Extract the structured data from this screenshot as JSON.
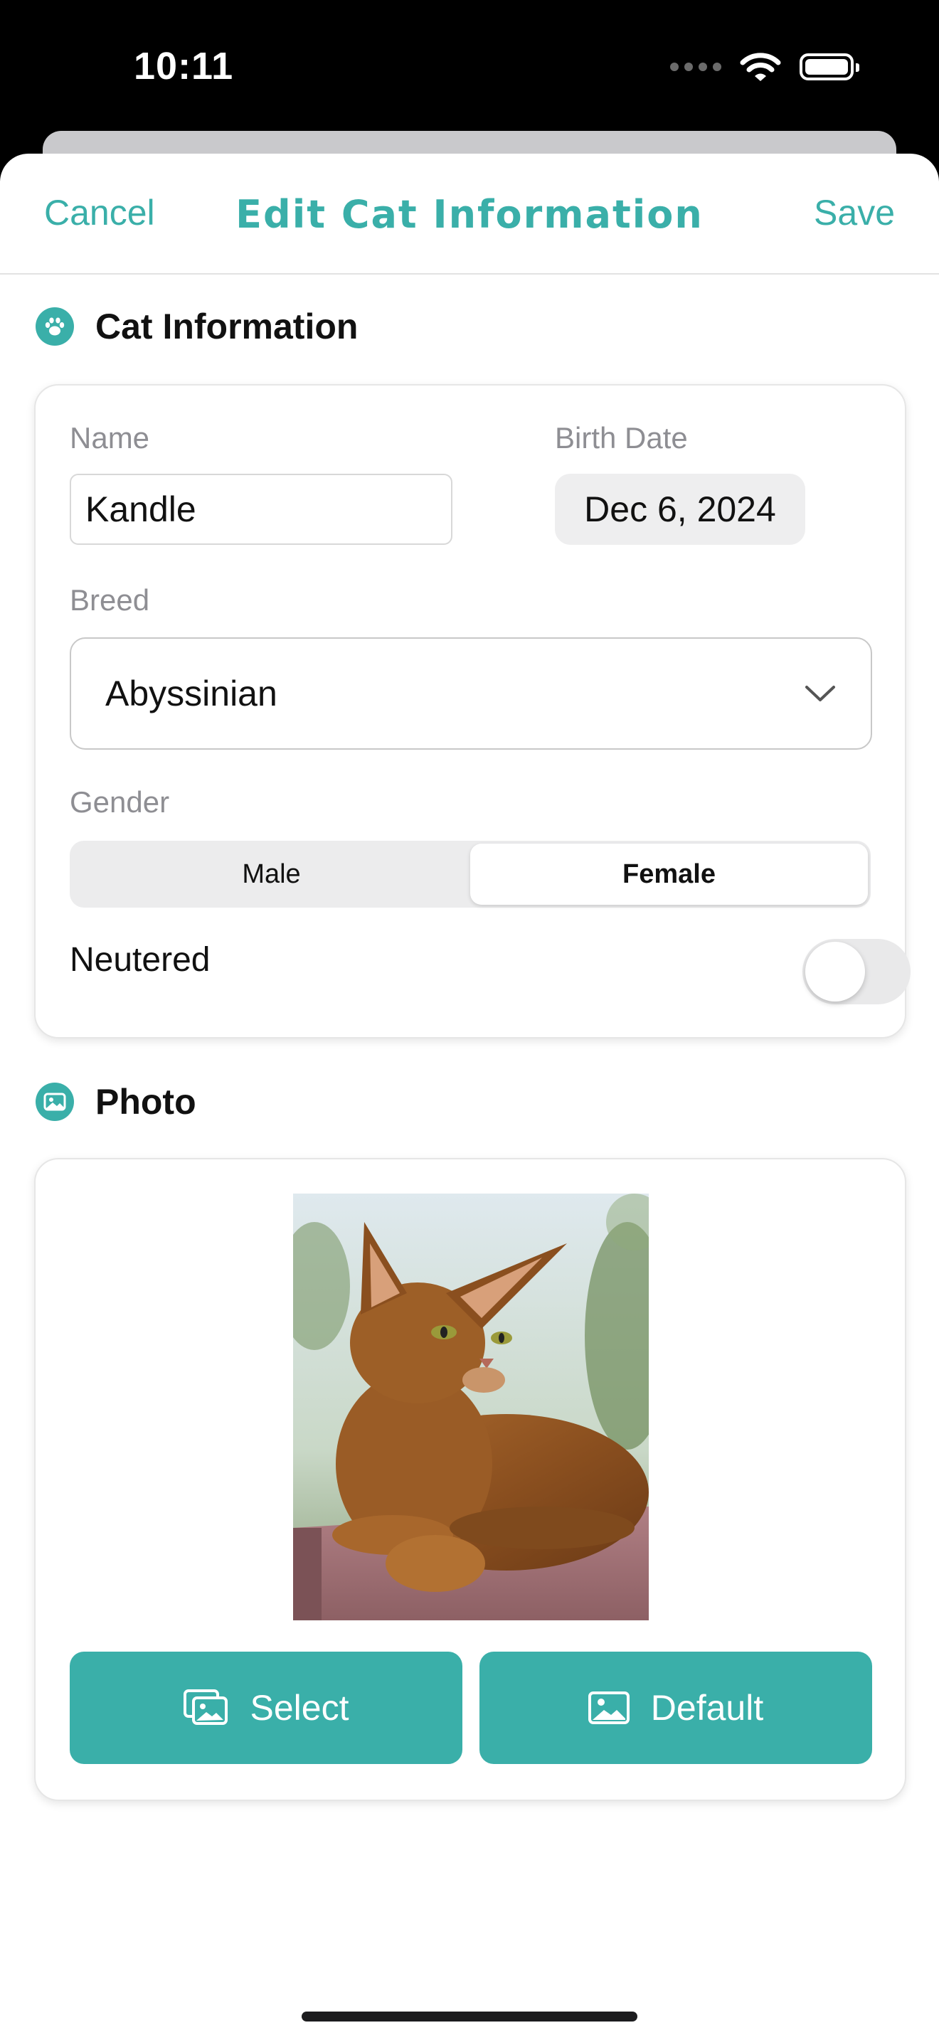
{
  "status_bar": {
    "time": "10:11"
  },
  "nav": {
    "cancel_label": "Cancel",
    "title": "Edit Cat Information",
    "save_label": "Save"
  },
  "cat_info": {
    "section_title": "Cat Information",
    "name_label": "Name",
    "name_value": "Kandle",
    "birth_date_label": "Birth Date",
    "birth_date_value": "Dec 6, 2024",
    "breed_label": "Breed",
    "breed_value": "Abyssinian",
    "gender_label": "Gender",
    "gender_options": [
      "Male",
      "Female"
    ],
    "gender_selected": "Female",
    "neutered_label": "Neutered",
    "neutered_on": false
  },
  "photo": {
    "section_title": "Photo",
    "select_label": "Select",
    "default_label": "Default"
  },
  "colors": {
    "accent": "#3aafa9",
    "background": "#ffffff"
  },
  "icons": [
    "paw-icon",
    "photo-icon",
    "chevron-down-icon",
    "photo-stack-icon",
    "image-icon",
    "wifi-icon",
    "battery-icon"
  ]
}
